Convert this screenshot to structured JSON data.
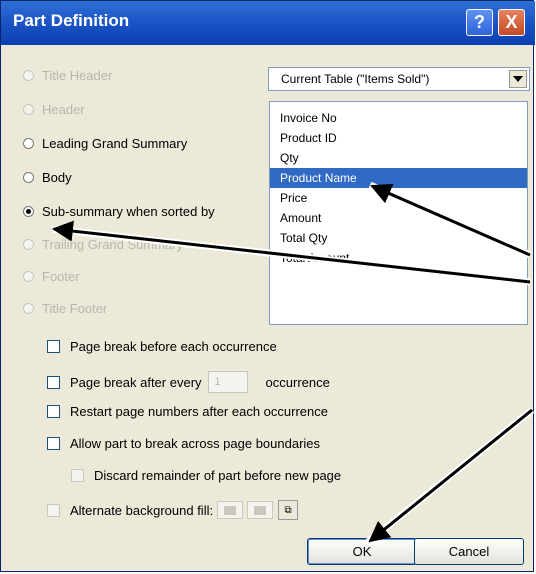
{
  "window": {
    "title": "Part Definition",
    "help_glyph": "?",
    "close_glyph": "X"
  },
  "parts": [
    {
      "label": "Title Header",
      "enabled": false,
      "selected": false
    },
    {
      "label": "Header",
      "enabled": false,
      "selected": false
    },
    {
      "label": "Leading Grand Summary",
      "enabled": true,
      "selected": false
    },
    {
      "label": "Body",
      "enabled": true,
      "selected": false
    },
    {
      "label": "Sub-summary when sorted by",
      "enabled": true,
      "selected": true
    },
    {
      "label": "Trailing Grand Summary",
      "enabled": false,
      "selected": false
    },
    {
      "label": "Footer",
      "enabled": false,
      "selected": false
    },
    {
      "label": "Title Footer",
      "enabled": false,
      "selected": false
    }
  ],
  "table_select": {
    "value": "Current Table (\"Items Sold\")"
  },
  "fields": [
    {
      "label": "Invoice No",
      "selected": false
    },
    {
      "label": "Product ID",
      "selected": false
    },
    {
      "label": "Qty",
      "selected": false
    },
    {
      "label": "Product Name",
      "selected": true
    },
    {
      "label": "Price",
      "selected": false
    },
    {
      "label": "Amount",
      "selected": false
    },
    {
      "label": "Total Qty",
      "selected": false
    },
    {
      "label": "Total Amount",
      "selected": false
    }
  ],
  "options": {
    "page_break_before": "Page break before each occurrence",
    "page_break_after": "Page break after every",
    "page_break_after_value": "1",
    "page_break_after_suffix": "occurrence",
    "restart_numbers": "Restart page numbers after each occurrence",
    "allow_break": "Allow part to break across page boundaries",
    "discard_remainder": "Discard remainder of part before new page",
    "alternate_fill": "Alternate background fill:"
  },
  "buttons": {
    "ok": "OK",
    "cancel": "Cancel"
  },
  "colors": {
    "title_bar": "#1d56c7",
    "selection": "#316ac5",
    "dialog_bg": "#ece9d8"
  }
}
